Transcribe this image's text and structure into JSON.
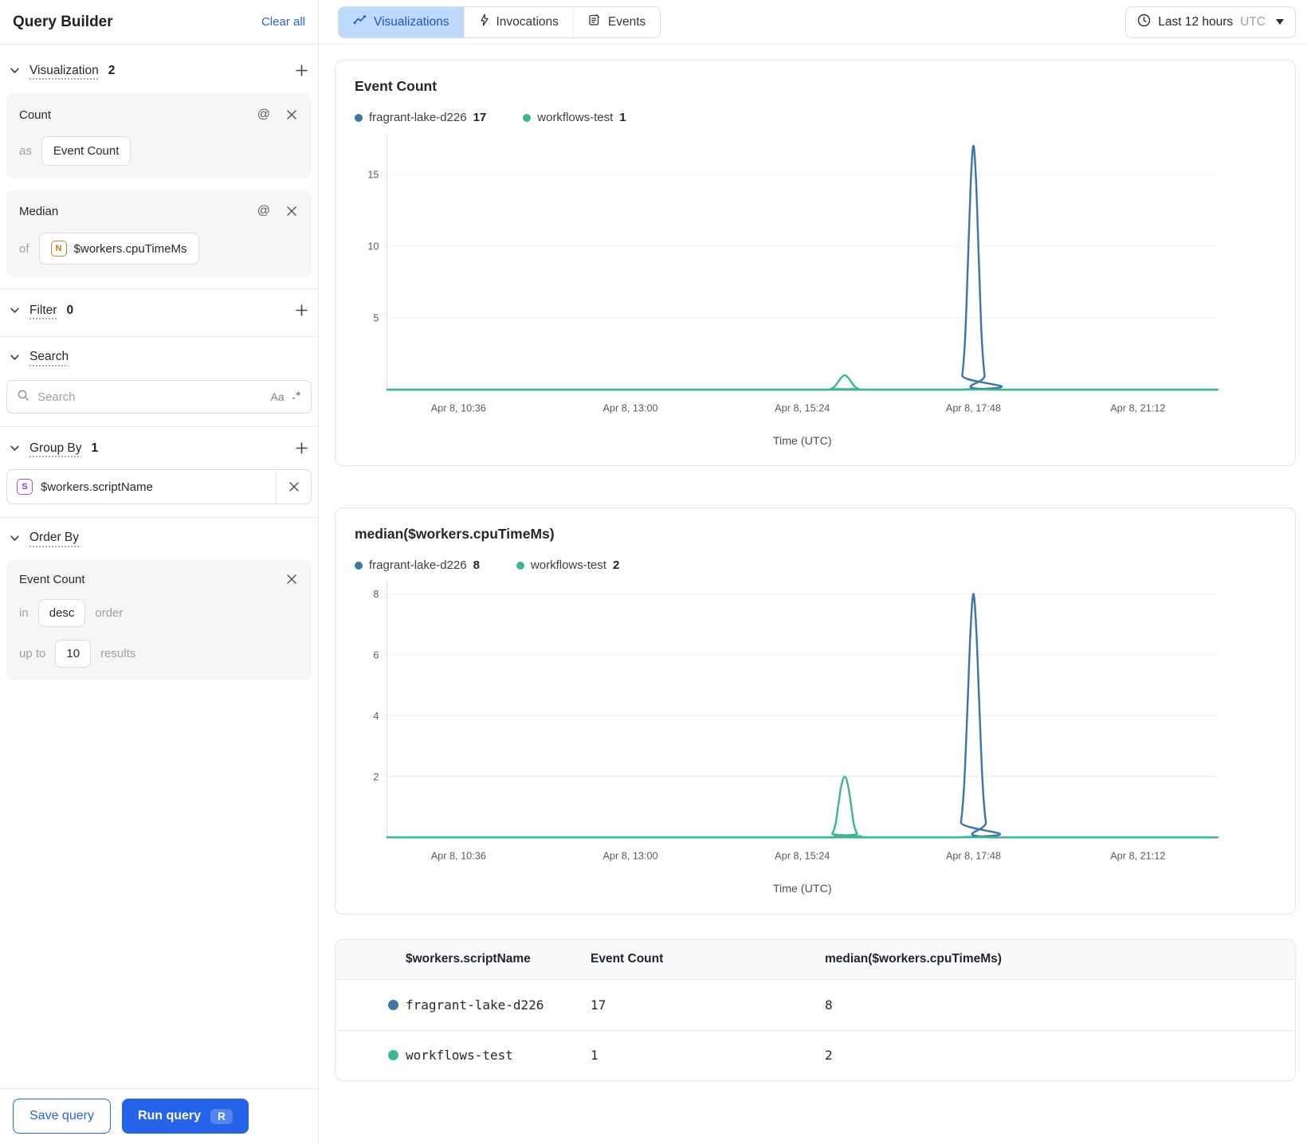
{
  "colors": {
    "accent": "#2563eb",
    "series_blue": "#3e75aa",
    "series_green": "#3cb98c"
  },
  "sidebar": {
    "title": "Query Builder",
    "clear_all": "Clear all",
    "visualization": {
      "label": "Visualization",
      "count": "2",
      "cards": [
        {
          "title": "Count",
          "prefix": "as",
          "value": "Event Count"
        },
        {
          "title": "Median",
          "prefix": "of",
          "badge": "N",
          "value": "$workers.cpuTimeMs"
        }
      ]
    },
    "filter": {
      "label": "Filter",
      "count": "0"
    },
    "search": {
      "label": "Search",
      "placeholder": "Search",
      "case_toggle": "Aa",
      "regex_toggle": ".*"
    },
    "group_by": {
      "label": "Group By",
      "count": "1",
      "chip": {
        "badge": "S",
        "value": "$workers.scriptName"
      }
    },
    "order_by": {
      "label": "Order By",
      "field": "Event Count",
      "in_label": "in",
      "direction": "desc",
      "order_label": "order",
      "up_to_label": "up to",
      "limit": "10",
      "results_label": "results"
    },
    "footer": {
      "save": "Save query",
      "run": "Run query",
      "run_shortcut": "R"
    }
  },
  "topbar": {
    "tabs": [
      {
        "label": "Visualizations"
      },
      {
        "label": "Invocations"
      },
      {
        "label": "Events"
      }
    ],
    "time_range": {
      "label": "Last 12 hours",
      "zone": "UTC"
    }
  },
  "charts": [
    {
      "title": "Event Count",
      "legend": [
        {
          "name": "fragrant-lake-d226",
          "value": "17"
        },
        {
          "name": "workflows-test",
          "value": "1"
        }
      ]
    },
    {
      "title": "median($workers.cpuTimeMs)",
      "legend": [
        {
          "name": "fragrant-lake-d226",
          "value": "8"
        },
        {
          "name": "workflows-test",
          "value": "2"
        }
      ]
    }
  ],
  "chart_data": [
    {
      "type": "line",
      "title": "Event Count",
      "xlabel": "Time (UTC)",
      "ylim": [
        0,
        17.6
      ],
      "y_ticks": [
        5,
        10,
        15
      ],
      "grid": true,
      "legend_position": "top",
      "x_ticks": [
        {
          "label": "Apr 8, 10:36",
          "pos": 0.086
        },
        {
          "label": "Apr 8, 13:00",
          "pos": 0.293
        },
        {
          "label": "Apr 8, 15:24",
          "pos": 0.5
        },
        {
          "label": "Apr 8, 17:48",
          "pos": 0.706
        },
        {
          "label": "Apr 8, 21:12",
          "pos": 0.904
        }
      ],
      "series": [
        {
          "name": "fragrant-lake-d226",
          "color": "#3e75aa",
          "peak_label": 17,
          "points": [
            [
              0,
              0
            ],
            [
              0.688,
              0
            ],
            [
              0.6925,
              1
            ],
            [
              0.6961,
              3.7
            ],
            [
              0.6997,
              9.4
            ],
            [
              0.7028,
              14.5
            ],
            [
              0.706,
              17
            ],
            [
              0.7092,
              14.5
            ],
            [
              0.7123,
              9.4
            ],
            [
              0.7159,
              3.7
            ],
            [
              0.7195,
              1
            ],
            [
              0.724,
              0
            ],
            [
              1,
              0
            ]
          ]
        },
        {
          "name": "workflows-test",
          "color": "#3cb98c",
          "peak_label": 1,
          "points": [
            [
              0,
              0
            ],
            [
              0.529,
              0
            ],
            [
              0.5345,
              0.06
            ],
            [
              0.5389,
              0.22
            ],
            [
              0.5433,
              0.55
            ],
            [
              0.547,
              0.85
            ],
            [
              0.551,
              1
            ],
            [
              0.555,
              0.85
            ],
            [
              0.5587,
              0.55
            ],
            [
              0.5631,
              0.22
            ],
            [
              0.5675,
              0.06
            ],
            [
              0.573,
              0
            ],
            [
              1,
              0
            ]
          ]
        }
      ]
    },
    {
      "type": "line",
      "title": "median($workers.cpuTimeMs)",
      "xlabel": "Time (UTC)",
      "ylim": [
        0,
        8.3
      ],
      "y_ticks": [
        2,
        4,
        6,
        8
      ],
      "grid": true,
      "legend_position": "top",
      "x_ticks": [
        {
          "label": "Apr 8, 10:36",
          "pos": 0.086
        },
        {
          "label": "Apr 8, 13:00",
          "pos": 0.293
        },
        {
          "label": "Apr 8, 15:24",
          "pos": 0.5
        },
        {
          "label": "Apr 8, 17:48",
          "pos": 0.706
        },
        {
          "label": "Apr 8, 21:12",
          "pos": 0.904
        }
      ],
      "series": [
        {
          "name": "fragrant-lake-d226",
          "color": "#3e75aa",
          "peak_label": 8,
          "points": [
            [
              0,
              0
            ],
            [
              0.686,
              0
            ],
            [
              0.691,
              0.5
            ],
            [
              0.695,
              1.8
            ],
            [
              0.699,
              4.4
            ],
            [
              0.7025,
              6.8
            ],
            [
              0.706,
              8
            ],
            [
              0.7095,
              6.8
            ],
            [
              0.713,
              4.4
            ],
            [
              0.717,
              1.8
            ],
            [
              0.721,
              0.5
            ],
            [
              0.726,
              0
            ],
            [
              1,
              0
            ]
          ]
        },
        {
          "name": "workflows-test",
          "color": "#3cb98c",
          "peak_label": 2,
          "points": [
            [
              0,
              0
            ],
            [
              0.531,
              0
            ],
            [
              0.536,
              0.12
            ],
            [
              0.54,
              0.44
            ],
            [
              0.5435,
              1.1
            ],
            [
              0.547,
              1.7
            ],
            [
              0.551,
              2
            ],
            [
              0.555,
              1.7
            ],
            [
              0.5585,
              1.1
            ],
            [
              0.562,
              0.44
            ],
            [
              0.566,
              0.12
            ],
            [
              0.571,
              0
            ],
            [
              1,
              0
            ]
          ]
        }
      ]
    }
  ],
  "table": {
    "headers": [
      "$workers.scriptName",
      "Event Count",
      "median($workers.cpuTimeMs)"
    ],
    "rows": [
      {
        "name": "fragrant-lake-d226",
        "event_count": "17",
        "median": "8"
      },
      {
        "name": "workflows-test",
        "event_count": "1",
        "median": "2"
      }
    ]
  }
}
